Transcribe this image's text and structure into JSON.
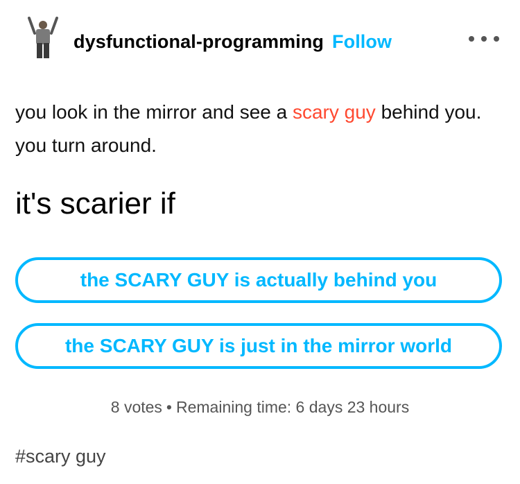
{
  "post": {
    "blog_name": "dysfunctional-programming",
    "follow_label": "Follow",
    "more_icon": "ellipsis-icon",
    "body_before_link": "you look in the mirror and see a ",
    "body_link": "scary guy",
    "body_after_link": " behind you. you turn around.",
    "link_color": "#ff4930"
  },
  "poll": {
    "question": "it's scarier if",
    "options": [
      {
        "label": "the SCARY GUY is actually behind you"
      },
      {
        "label": "the SCARY GUY is just in the mirror world"
      }
    ],
    "votes": "8 votes",
    "separator": "•",
    "remaining": "Remaining time: 6 days 23 hours",
    "accent_color": "#00b8ff"
  },
  "tags": [
    "#scary guy"
  ]
}
